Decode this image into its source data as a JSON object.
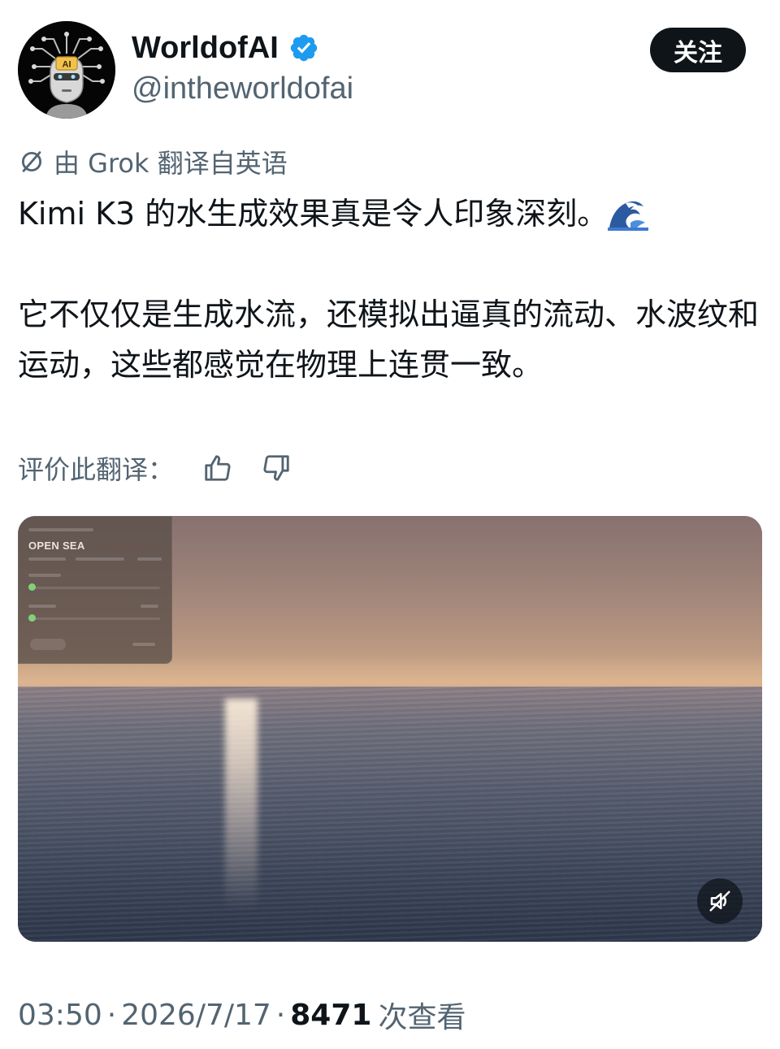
{
  "author": {
    "display_name": "WorldofAI",
    "handle": "@intheworldofai",
    "verified": true,
    "avatar_text": "AI"
  },
  "follow_button": {
    "label": "关注"
  },
  "translation": {
    "note": "由 Grok 翻译自英语",
    "rate_label": "评价此翻译："
  },
  "tweet": {
    "paragraph1": "Kimi K3 的水生成效果真是令人印象深刻。",
    "paragraph1_emoji": "water-wave-emoji",
    "paragraph2": "它不仅仅是生成水流，还模拟出逼真的流动、水波纹和运动，这些都感觉在物理上连贯一致。"
  },
  "media": {
    "type": "video",
    "panel_title": "OPEN SEA",
    "muted": true
  },
  "meta": {
    "time": "03:50",
    "separator": "·",
    "date": "2026/7/17",
    "views": "8471",
    "views_label": "次查看"
  },
  "colors": {
    "text_primary": "#0f1419",
    "text_secondary": "#536471",
    "verified_blue": "#1d9bf0",
    "follow_bg": "#0f1419"
  }
}
